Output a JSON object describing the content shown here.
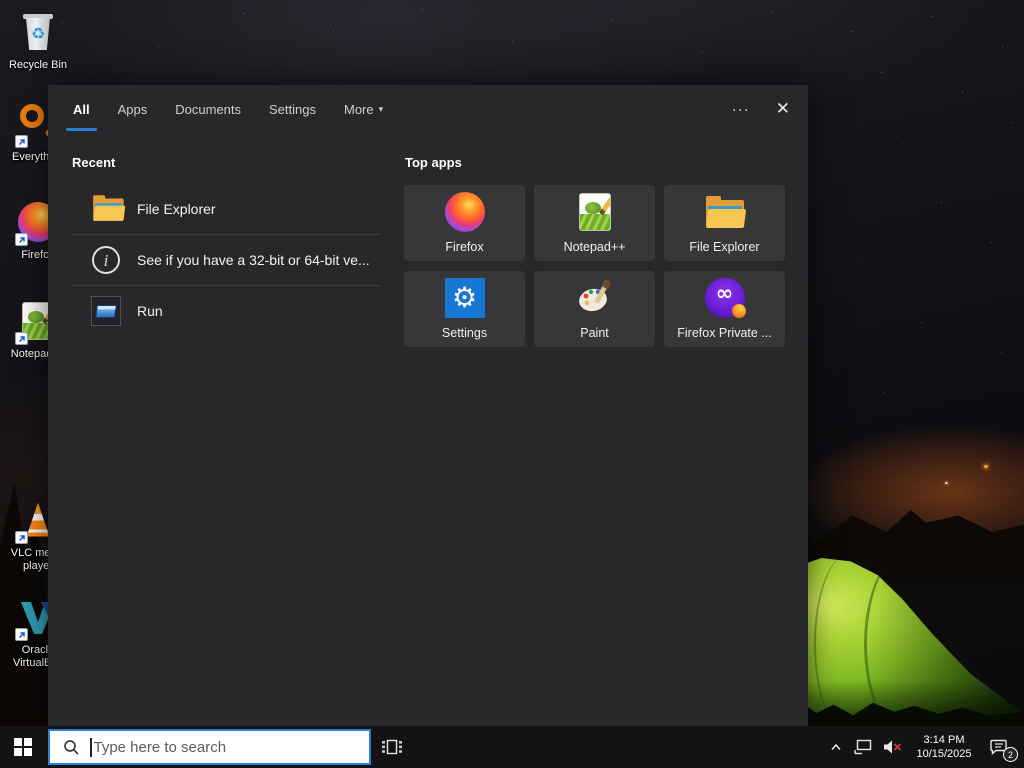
{
  "glyphs": {
    "dropdown": "▾",
    "ellipsis": "···",
    "close": "✕",
    "recycle": "♻",
    "gear": "⚙",
    "infinity": "∞",
    "info": "i"
  },
  "desktop": {
    "icons": [
      {
        "name": "recycle-bin",
        "label": "Recycle Bin"
      },
      {
        "name": "everything",
        "label": "Everything"
      },
      {
        "name": "firefox",
        "label": "Firefox"
      },
      {
        "name": "notepad-plus-plus",
        "label": "Notepad++"
      },
      {
        "name": "vlc-media-player",
        "label": "VLC media player"
      },
      {
        "name": "oracle-virtualbox",
        "label": "Oracle VirtualBox"
      }
    ]
  },
  "search_panel": {
    "tabs": [
      {
        "label": "All",
        "active": true
      },
      {
        "label": "Apps",
        "active": false
      },
      {
        "label": "Documents",
        "active": false
      },
      {
        "label": "Settings",
        "active": false
      },
      {
        "label": "More",
        "active": false,
        "has_dropdown": true
      }
    ],
    "recent": {
      "header": "Recent",
      "items": [
        {
          "icon": "folder-icon",
          "label": "File Explorer"
        },
        {
          "icon": "info-icon",
          "label": "See if you have a 32-bit or 64-bit ve..."
        },
        {
          "icon": "run-icon",
          "label": "Run"
        }
      ]
    },
    "top_apps": {
      "header": "Top apps",
      "tiles": [
        {
          "icon": "firefox-icon",
          "label": "Firefox"
        },
        {
          "icon": "notepad-plus-plus-icon",
          "label": "Notepad++"
        },
        {
          "icon": "file-explorer-icon",
          "label": "File Explorer"
        },
        {
          "icon": "settings-icon",
          "label": "Settings"
        },
        {
          "icon": "paint-icon",
          "label": "Paint"
        },
        {
          "icon": "firefox-private-icon",
          "label": "Firefox Private ..."
        }
      ]
    }
  },
  "taskbar": {
    "search": {
      "placeholder": "Type here to search"
    },
    "tray": {
      "time": "3:14 PM",
      "date": "10/15/2025",
      "notification_count": "2"
    }
  },
  "colors": {
    "accent_blue": "#2e7cd6",
    "settings_tile_blue": "#1877d2",
    "panel_bg": "#28282b",
    "tile_bg": "#373739",
    "taskbar_bg": "#131316",
    "tent_green": "#9ccb30",
    "mute_red": "#d13b3b"
  }
}
